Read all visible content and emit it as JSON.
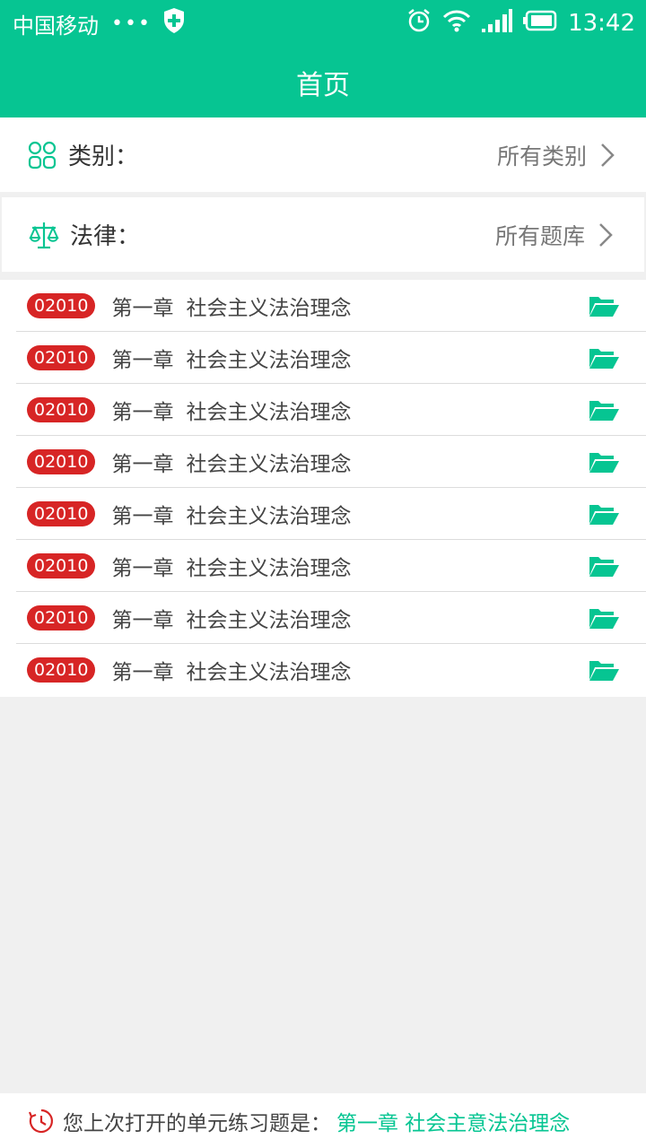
{
  "status_bar": {
    "carrier": "中国移动",
    "dots": "•••",
    "time": "13:42"
  },
  "header": {
    "title": "首页"
  },
  "filters": {
    "category": {
      "label": "类别：",
      "value": "所有类别"
    },
    "law": {
      "label": "法律：",
      "value": "所有题库"
    }
  },
  "chapters": [
    {
      "code": "02010",
      "chapter": "第一章",
      "title": "社会主义法治理念"
    },
    {
      "code": "02010",
      "chapter": "第一章",
      "title": "社会主义法治理念"
    },
    {
      "code": "02010",
      "chapter": "第一章",
      "title": "社会主义法治理念"
    },
    {
      "code": "02010",
      "chapter": "第一章",
      "title": "社会主义法治理念"
    },
    {
      "code": "02010",
      "chapter": "第一章",
      "title": "社会主义法治理念"
    },
    {
      "code": "02010",
      "chapter": "第一章",
      "title": "社会主义法治理念"
    },
    {
      "code": "02010",
      "chapter": "第一章",
      "title": "社会主义法治理念"
    },
    {
      "code": "02010",
      "chapter": "第一章",
      "title": "社会主义法治理念"
    }
  ],
  "footer": {
    "text": "您上次打开的单元练习题是：",
    "link": "第一章 社会主意法治理念"
  },
  "colors": {
    "accent": "#06c592",
    "badge": "#d72525"
  },
  "icons": {
    "category": "grid-icon",
    "law": "scales-icon",
    "chevron": "chevron-right-icon",
    "folder": "folder-open-icon",
    "history": "history-clock-icon"
  }
}
